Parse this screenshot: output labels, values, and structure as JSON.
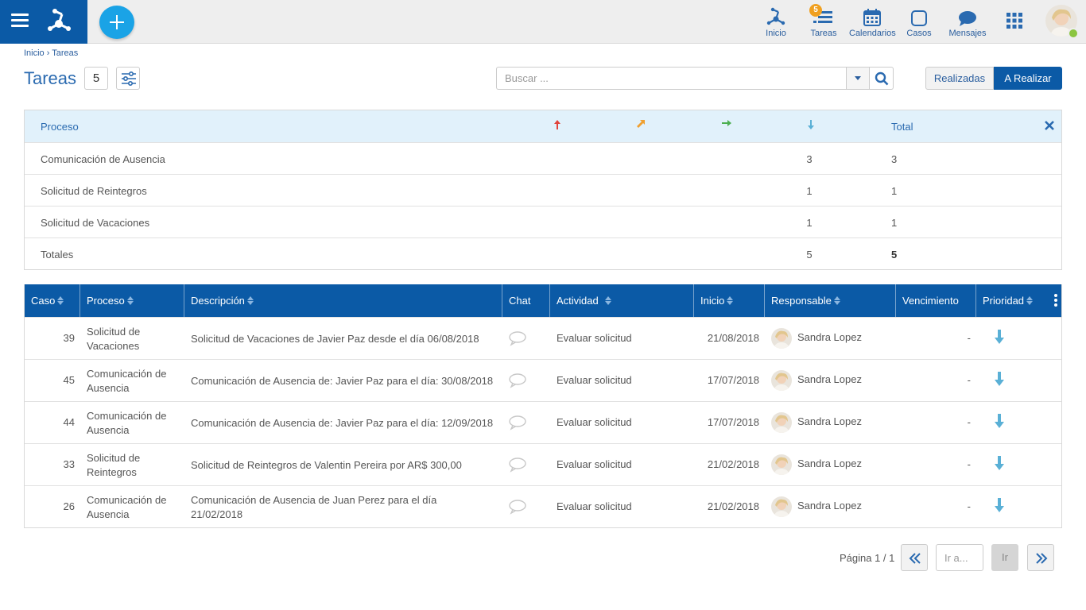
{
  "nav": {
    "items": [
      {
        "label": "Inicio",
        "icon": "process-icon"
      },
      {
        "label": "Tareas",
        "icon": "tasks-icon",
        "badge": "5"
      },
      {
        "label": "Calendarios",
        "icon": "calendar-icon"
      },
      {
        "label": "Casos",
        "icon": "cases-icon"
      },
      {
        "label": "Mensajes",
        "icon": "messages-icon"
      }
    ],
    "brand_color": "#0b5aa6",
    "add_color": "#1aa3e6"
  },
  "breadcrumb": {
    "home": "Inicio",
    "sep": "›",
    "current": "Tareas"
  },
  "page": {
    "title": "Tareas",
    "count": "5"
  },
  "search": {
    "placeholder": "Buscar ..."
  },
  "toggle": {
    "done": "Realizadas",
    "todo": "A Realizar",
    "active": "A Realizar"
  },
  "summary": {
    "headers": {
      "process": "Proceso",
      "total": "Total"
    },
    "priority_icons": [
      "arrow-up-red-icon",
      "arrow-upright-orange-icon",
      "arrow-right-green-icon",
      "arrow-down-blue-icon"
    ],
    "rows": [
      {
        "process": "Comunicación de Ausencia",
        "low": "3",
        "total": "3"
      },
      {
        "process": "Solicitud de Reintegros",
        "low": "1",
        "total": "1"
      },
      {
        "process": "Solicitud de Vacaciones",
        "low": "1",
        "total": "1"
      }
    ],
    "totals": {
      "label": "Totales",
      "low": "5",
      "total": "5"
    }
  },
  "table": {
    "columns": {
      "caso": "Caso",
      "proceso": "Proceso",
      "descripcion": "Descripción",
      "chat": "Chat",
      "actividad": "Actividad",
      "inicio": "Inicio",
      "responsable": "Responsable",
      "vencimiento": "Vencimiento",
      "prioridad": "Prioridad"
    },
    "rows": [
      {
        "caso": "39",
        "proceso": "Solicitud de Vacaciones",
        "descripcion": "Solicitud de Vacaciones de Javier  Paz desde el día 06/08/2018",
        "actividad": "Evaluar solicitud",
        "inicio": "21/08/2018",
        "responsable": "Sandra Lopez",
        "vencimiento": "-",
        "prioridad": "baja"
      },
      {
        "caso": "45",
        "proceso": "Comunicación de Ausencia",
        "descripcion": "Comunicación de Ausencia de: Javier Paz para el día: 30/08/2018",
        "actividad": "Evaluar solicitud",
        "inicio": "17/07/2018",
        "responsable": "Sandra Lopez",
        "vencimiento": "-",
        "prioridad": "baja"
      },
      {
        "caso": "44",
        "proceso": "Comunicación de Ausencia",
        "descripcion": "Comunicación de Ausencia de: Javier Paz para el día: 12/09/2018",
        "actividad": "Evaluar solicitud",
        "inicio": "17/07/2018",
        "responsable": "Sandra Lopez",
        "vencimiento": "-",
        "prioridad": "baja"
      },
      {
        "caso": "33",
        "proceso": "Solicitud de Reintegros",
        "descripcion": "Solicitud de Reintegros de Valentin  Pereira por  AR$  300,00",
        "actividad": "Evaluar solicitud",
        "inicio": "21/02/2018",
        "responsable": "Sandra Lopez",
        "vencimiento": "-",
        "prioridad": "baja"
      },
      {
        "caso": "26",
        "proceso": "Comunicación de Ausencia",
        "descripcion": "Comunicación de Ausencia de Juan  Perez para el día 21/02/2018",
        "actividad": "Evaluar solicitud",
        "inicio": "21/02/2018",
        "responsable": "Sandra Lopez",
        "vencimiento": "-",
        "prioridad": "baja"
      }
    ]
  },
  "pagination": {
    "label": "Página 1 / 1",
    "goto_placeholder": "Ir a...",
    "go": "Ir"
  }
}
